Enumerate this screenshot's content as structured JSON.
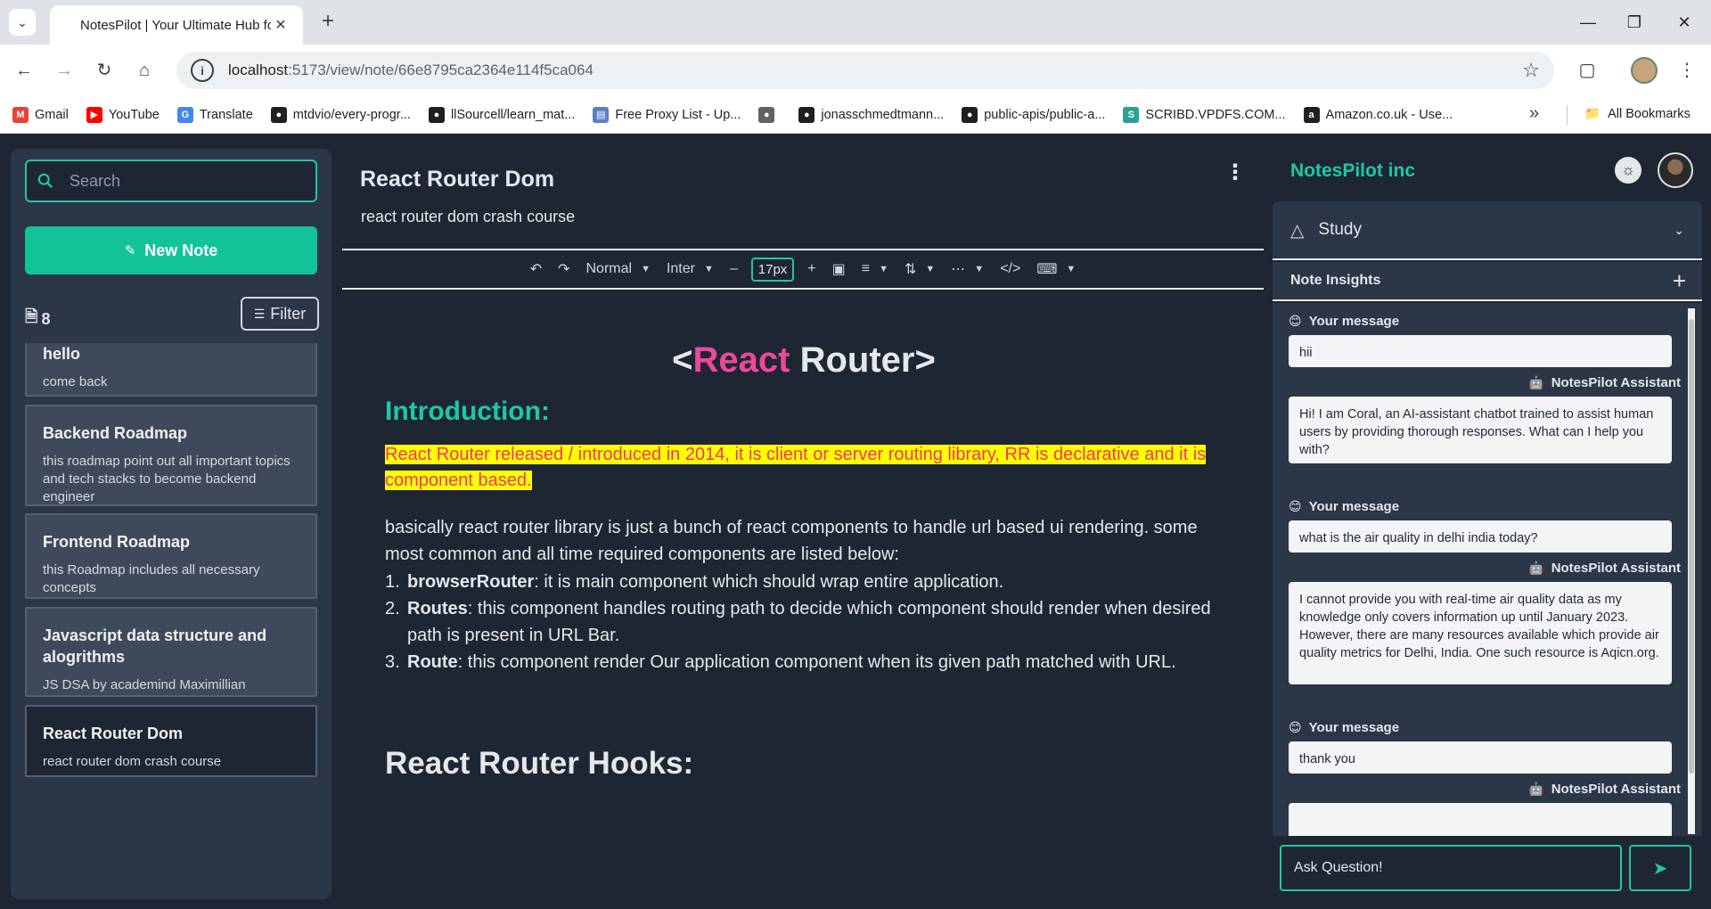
{
  "browser": {
    "tab_title": "NotesPilot | Your Ultimate Hub for",
    "url_host": "localhost",
    "url_path": ":5173/view/note/66e8795ca2364e114f5ca064",
    "bookmarks": [
      {
        "label": "Gmail",
        "color": "#ea4335",
        "icon": "gmail-icon"
      },
      {
        "label": "YouTube",
        "color": "#ff0000",
        "icon": "youtube-icon"
      },
      {
        "label": "Translate",
        "color": "#4285f4",
        "icon": "translate-icon"
      },
      {
        "label": "mtdvio/every-progr...",
        "color": "#1f1f1f",
        "icon": "github-icon"
      },
      {
        "label": "llSourcell/learn_mat...",
        "color": "#1f1f1f",
        "icon": "github-icon"
      },
      {
        "label": "Free Proxy List - Up...",
        "color": "#5b7fc7",
        "icon": "proxy-icon"
      },
      {
        "label": "",
        "color": "#5f6368",
        "icon": "globe-icon"
      },
      {
        "label": "jonasschmedtmann...",
        "color": "#1f1f1f",
        "icon": "github-icon"
      },
      {
        "label": "public-apis/public-a...",
        "color": "#1f1f1f",
        "icon": "github-icon"
      },
      {
        "label": "SCRIBD.VPDFS.COM...",
        "color": "#2aa198",
        "icon": "scribd-icon"
      },
      {
        "label": "Amazon.co.uk - Use...",
        "color": "#1f1f1f",
        "icon": "amazon-icon"
      }
    ],
    "all_bookmarks": "All Bookmarks"
  },
  "sidebar": {
    "search_placeholder": "Search",
    "new_note": "New Note",
    "note_count": "8",
    "filter": "Filter",
    "notes": [
      {
        "title": "hello",
        "desc": "come back"
      },
      {
        "title": "Backend Roadmap",
        "desc": "this roadmap point out all important topics and tech stacks to become backend engineer"
      },
      {
        "title": "Frontend Roadmap",
        "desc": "this Roadmap includes all necessary concepts"
      },
      {
        "title": "Javascript data structure and alogrithms",
        "desc": "JS DSA by academind Maximillian"
      },
      {
        "title": "React Router Dom",
        "desc": "react router dom crash course"
      }
    ]
  },
  "editor": {
    "title": "React Router Dom",
    "subtitle": "react router dom crash course",
    "toolbar": {
      "block_type": "Normal",
      "font": "Inter",
      "font_size": "17px"
    },
    "heading_prefix": "<",
    "heading_pink": "React",
    "heading_suffix": " Router>",
    "intro_heading": "Introduction:",
    "highlighted_text": "React Router released / introduced in 2014, it is client or server routing library, RR is declarative and it is component based.",
    "paragraph": "basically react router library is just a bunch of react components to handle url based ui rendering. some most common and all time required components are listed below:",
    "list": [
      {
        "num": "1.",
        "term": "browserRouter",
        "text": ": it is main component which should wrap entire application."
      },
      {
        "num": "2.",
        "term": "Routes",
        "text": ": this component handles routing path to decide which component should render when desired path is present in URL Bar."
      },
      {
        "num": "3.",
        "term": "Route",
        "text": ": this component render Our application component when its given path matched with URL."
      }
    ],
    "hooks_heading": "React Router Hooks:"
  },
  "right_panel": {
    "brand": "NotesPilot inc",
    "study_label": "Study",
    "insights_label": "Note Insights",
    "user_label": "Your message",
    "assistant_label": "NotesPilot Assistant",
    "messages": [
      {
        "from": "user",
        "text": "hii"
      },
      {
        "from": "assistant",
        "text": "Hi! I am Coral, an AI-assistant chatbot trained to assist human users by providing thorough responses. What can I help you with?"
      },
      {
        "from": "user",
        "text": "what is the air quality in delhi india today?"
      },
      {
        "from": "assistant",
        "text": "I cannot provide you with real-time air quality data as my knowledge only covers information up until January 2023. However, there are many resources available which provide air quality metrics for Delhi, India. One such resource is Aqicn.org."
      },
      {
        "from": "user",
        "text": "thank you"
      },
      {
        "from": "assistant",
        "text": ""
      }
    ],
    "ask_placeholder": "Ask Question!"
  },
  "colors": {
    "accent": "#1fc8a0",
    "primary_button": "#13c398",
    "pink": "#ec4899",
    "highlight_bg": "#ffff00",
    "highlight_text": "#f0366a",
    "app_bg": "#1e2633",
    "panel_bg": "#2b3647"
  }
}
